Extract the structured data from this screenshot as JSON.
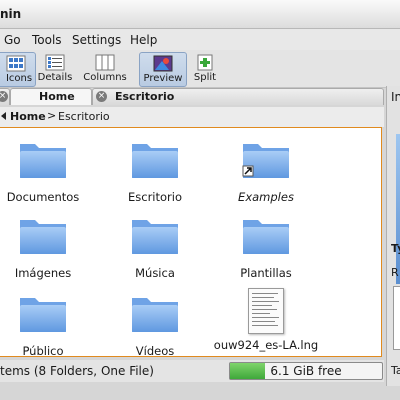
{
  "window": {
    "title": "nin"
  },
  "menubar": {
    "items": [
      "Go",
      "Tools",
      "Settings",
      "Help"
    ]
  },
  "toolbar": {
    "icons_label": "Icons",
    "details_label": "Details",
    "columns_label": "Columns",
    "preview_label": "Preview",
    "split_label": "Split"
  },
  "tabs": [
    {
      "label": "Home",
      "active": true
    },
    {
      "label": "Escritorio",
      "active": false
    }
  ],
  "breadcrumb": {
    "home": "Home",
    "separator": ">",
    "current": "Escritorio"
  },
  "items": [
    {
      "name": "Documentos",
      "type": "folder"
    },
    {
      "name": "Escritorio",
      "type": "folder"
    },
    {
      "name": "Examples",
      "type": "folder-link"
    },
    {
      "name": "Imágenes",
      "type": "folder"
    },
    {
      "name": "Música",
      "type": "folder"
    },
    {
      "name": "Plantillas",
      "type": "folder"
    },
    {
      "name": "Público",
      "type": "folder"
    },
    {
      "name": "Vídeos",
      "type": "folder"
    },
    {
      "name": "ouw924_es-LA.lng",
      "type": "file"
    }
  ],
  "status": {
    "summary": "tems (8 Folders, One File)",
    "free_space": "6.1 GiB free",
    "used_fraction": 0.23
  },
  "info_panel": {
    "caption1": "In",
    "caption2": "Ty",
    "caption3": "R",
    "caption4": "Ta"
  },
  "colors": {
    "folder": "#7aaef0",
    "accent": "#e08a1e"
  }
}
